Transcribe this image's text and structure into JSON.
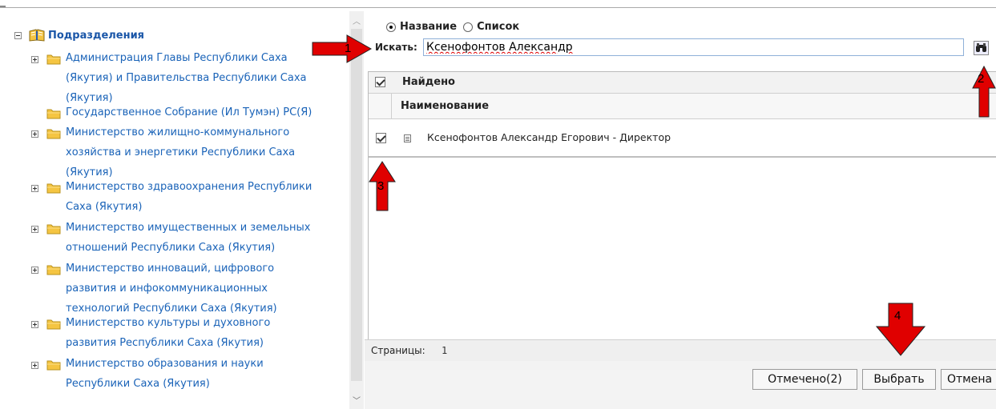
{
  "tree": {
    "root_label": "Подразделения",
    "items": [
      {
        "lines": [
          "Администрация Главы Республики Саха",
          "(Якутия) и Правительства Республики Саха",
          "(Якутия)"
        ],
        "expandable": true
      },
      {
        "lines": [
          "Государственное Собрание (Ил Тумэн) РС(Я)"
        ],
        "expandable": false
      },
      {
        "lines": [
          "Министерство жилищно-коммунального",
          "хозяйства и энергетики Республики Саха",
          "(Якутия)"
        ],
        "expandable": true
      },
      {
        "lines": [
          "Министерство здравоохранения Республики",
          "Саха (Якутия)"
        ],
        "expandable": true
      },
      {
        "lines": [
          "Министерство имущественных и земельных",
          "отношений Республики Саха (Якутия)"
        ],
        "expandable": true
      },
      {
        "lines": [
          "Министерство инноваций, цифрового",
          "развития и инфокоммуникационных",
          "технологий Республики Саха (Якутия)"
        ],
        "expandable": true
      },
      {
        "lines": [
          "Министерство культуры и духовного",
          "развития Республики Саха (Якутия)"
        ],
        "expandable": true
      },
      {
        "lines": [
          "Министерство образования и науки",
          "Республики Саха (Якутия)"
        ],
        "expandable": true
      }
    ]
  },
  "search": {
    "mode_options": [
      {
        "label": "Название",
        "checked": true
      },
      {
        "label": "Список",
        "checked": false
      }
    ],
    "label": "Искать:",
    "value": "Ксенофонтов Александр"
  },
  "results": {
    "found_label": "Найдено",
    "column_header": "Наименование",
    "rows": [
      {
        "label": "Ксенофонтов Александр Егорович - Директор",
        "checked": true
      }
    ],
    "pages_label": "Страницы:",
    "pages_value": "1"
  },
  "buttons": {
    "marked": "Отмечено(2)",
    "select": "Выбрать",
    "cancel": "Отмена"
  },
  "annotations": [
    "1",
    "2",
    "3",
    "4"
  ],
  "colors": {
    "link": "#1a63b8",
    "arrow": "#e00000",
    "folder": "#f5c542"
  }
}
